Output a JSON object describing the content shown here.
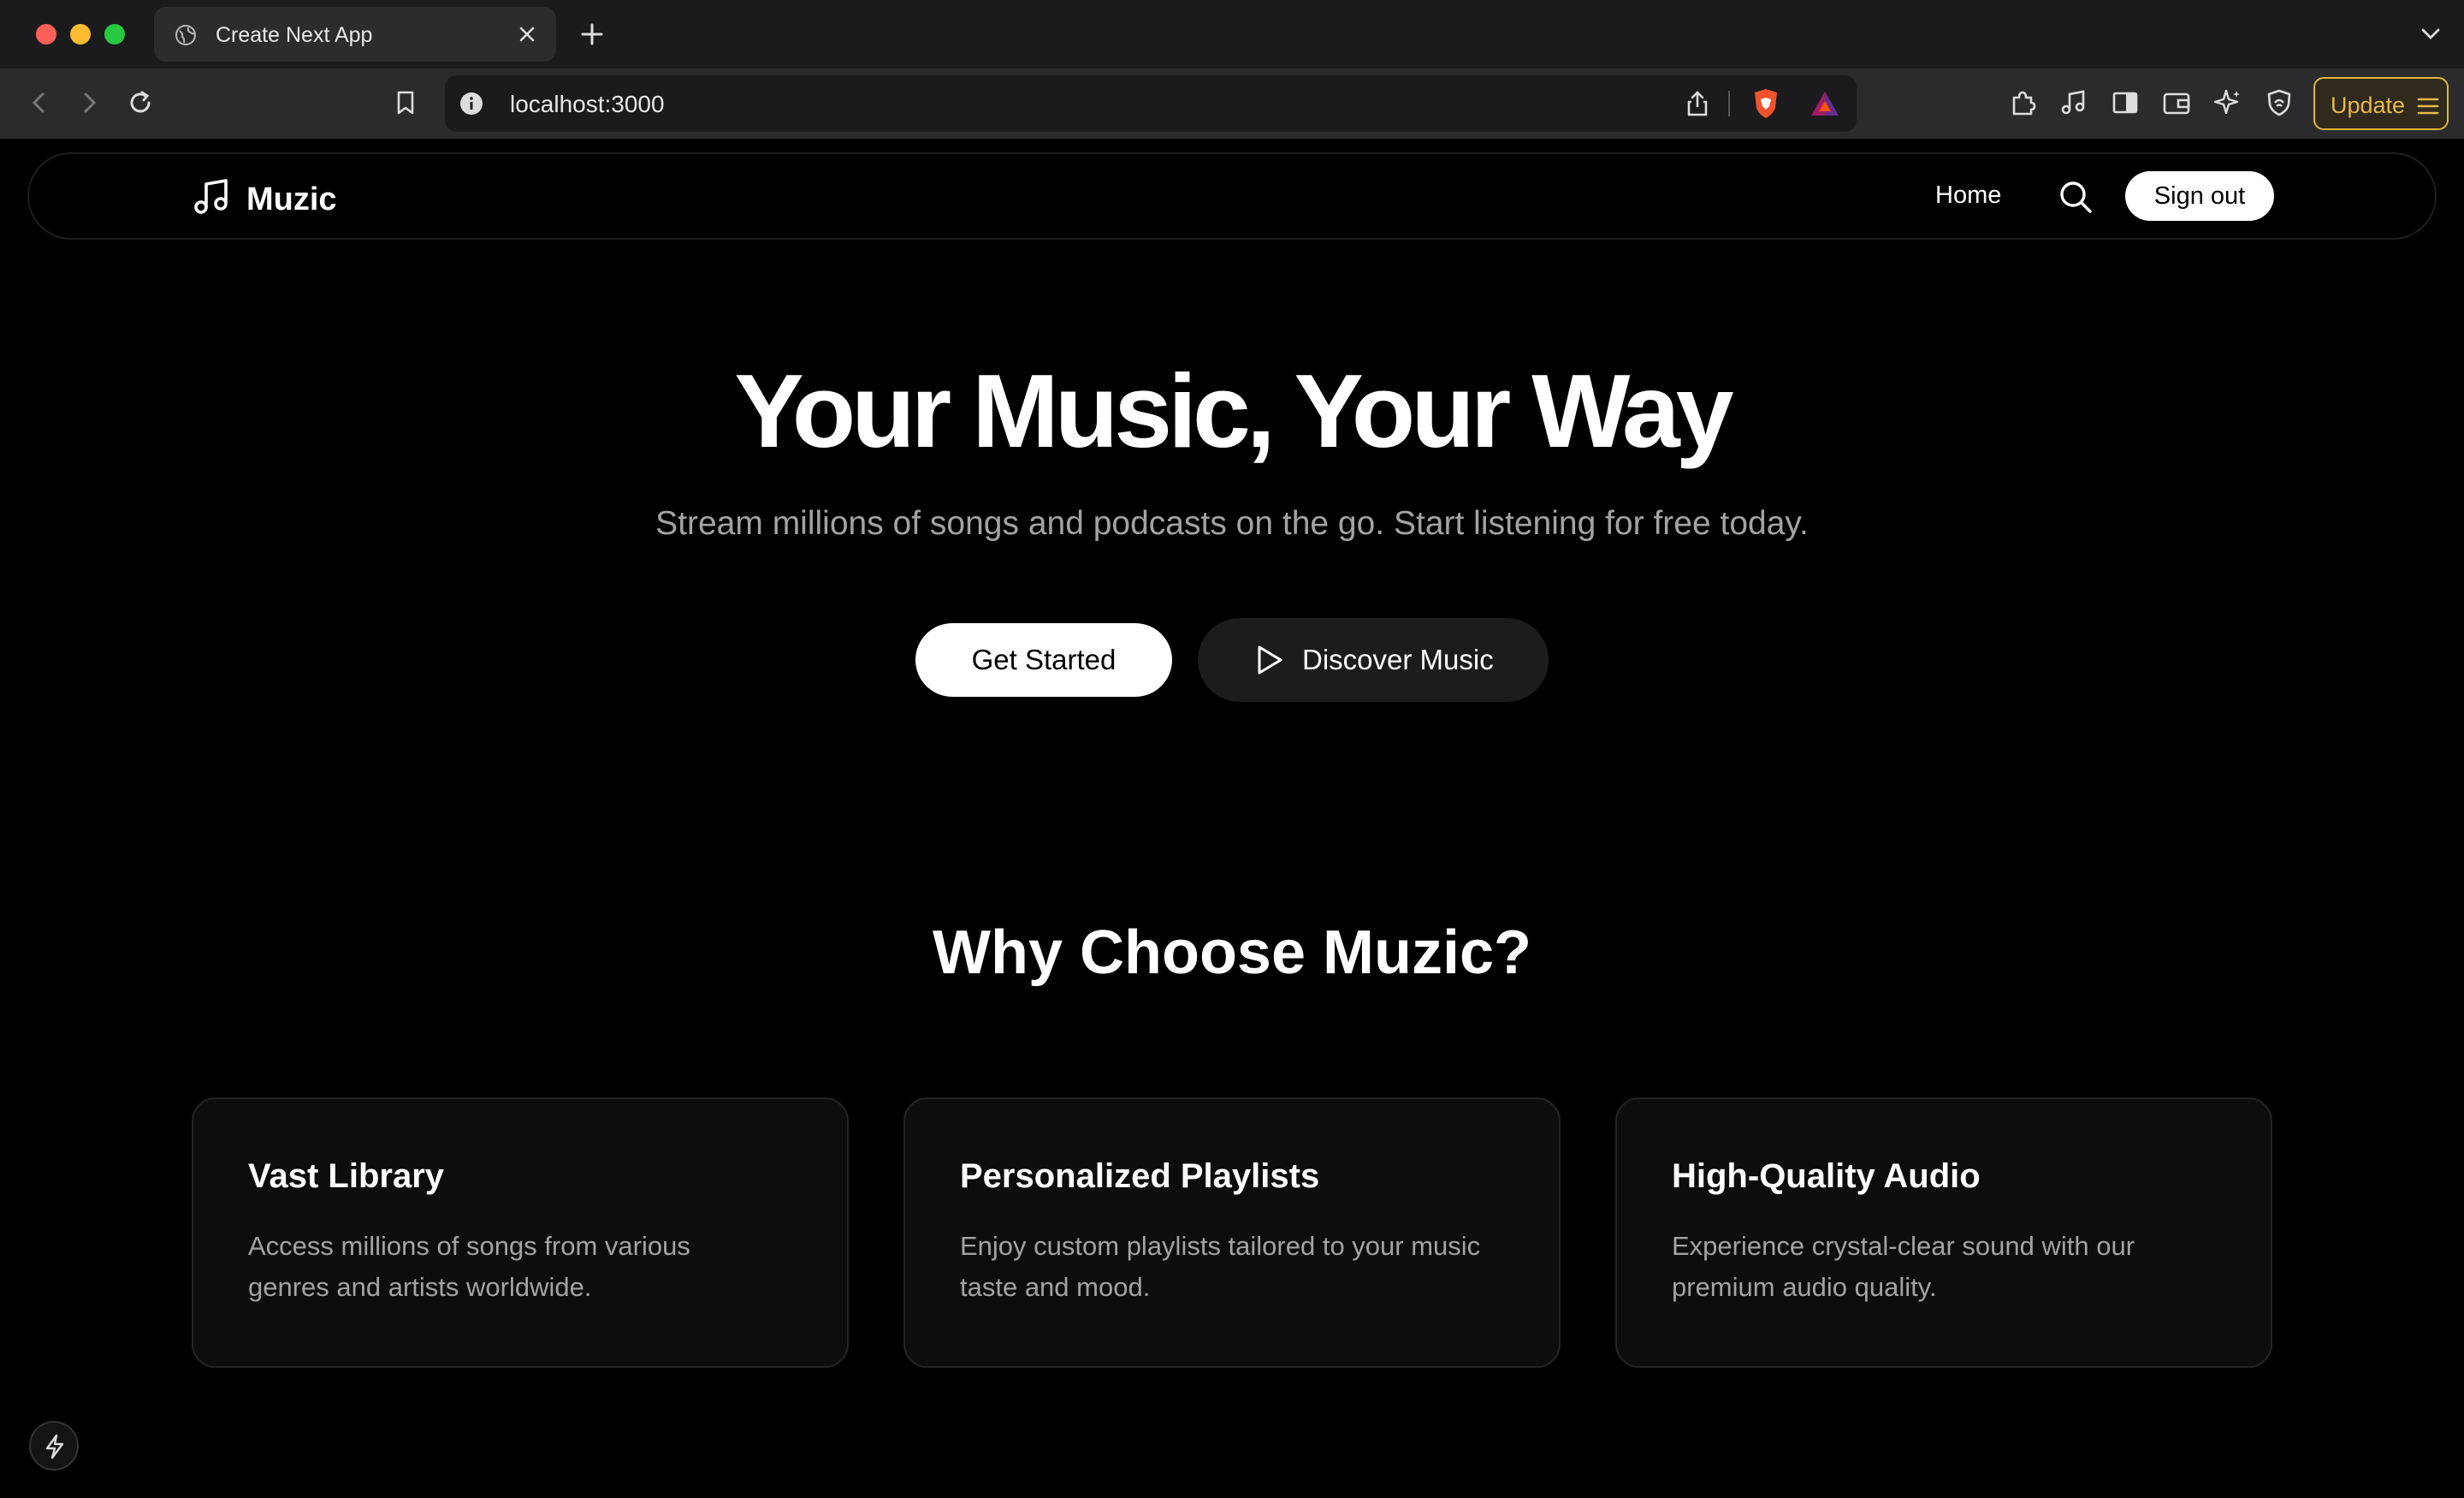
{
  "browser": {
    "tab_title": "Create Next App",
    "url": "localhost:3000",
    "update_label": "Update",
    "icons": [
      "globe-icon",
      "close-icon",
      "plus-icon",
      "chevron-down-icon",
      "back-icon",
      "forward-icon",
      "reload-icon",
      "bookmark-icon",
      "info-icon",
      "share-icon",
      "brave-shield-icon",
      "bat-rewards-icon",
      "extensions-icon",
      "media-icon",
      "sidebar-icon",
      "wallet-icon",
      "leo-ai-icon",
      "vpn-icon",
      "menu-icon"
    ]
  },
  "navbar": {
    "brand": "Muzic",
    "home_label": "Home",
    "signout_label": "Sign out"
  },
  "hero": {
    "title": "Your Music, Your Way",
    "subtitle": "Stream millions of songs and podcasts on the go. Start listening for free today.",
    "cta_primary": "Get Started",
    "cta_secondary": "Discover Music"
  },
  "features": {
    "title": "Why Choose Muzic?",
    "cards": [
      {
        "title": "Vast Library",
        "description": "Access millions of songs from various genres and artists worldwide."
      },
      {
        "title": "Personalized Playlists",
        "description": "Enjoy custom playlists tailored to your music taste and mood."
      },
      {
        "title": "High-Quality Audio",
        "description": "Experience crystal-clear sound with our premium audio quality."
      }
    ]
  },
  "colors": {
    "background": "#000000",
    "muted_text": "#a3a3a3",
    "card_bg": "#0d0d0d",
    "update_accent": "#e8b84a"
  }
}
